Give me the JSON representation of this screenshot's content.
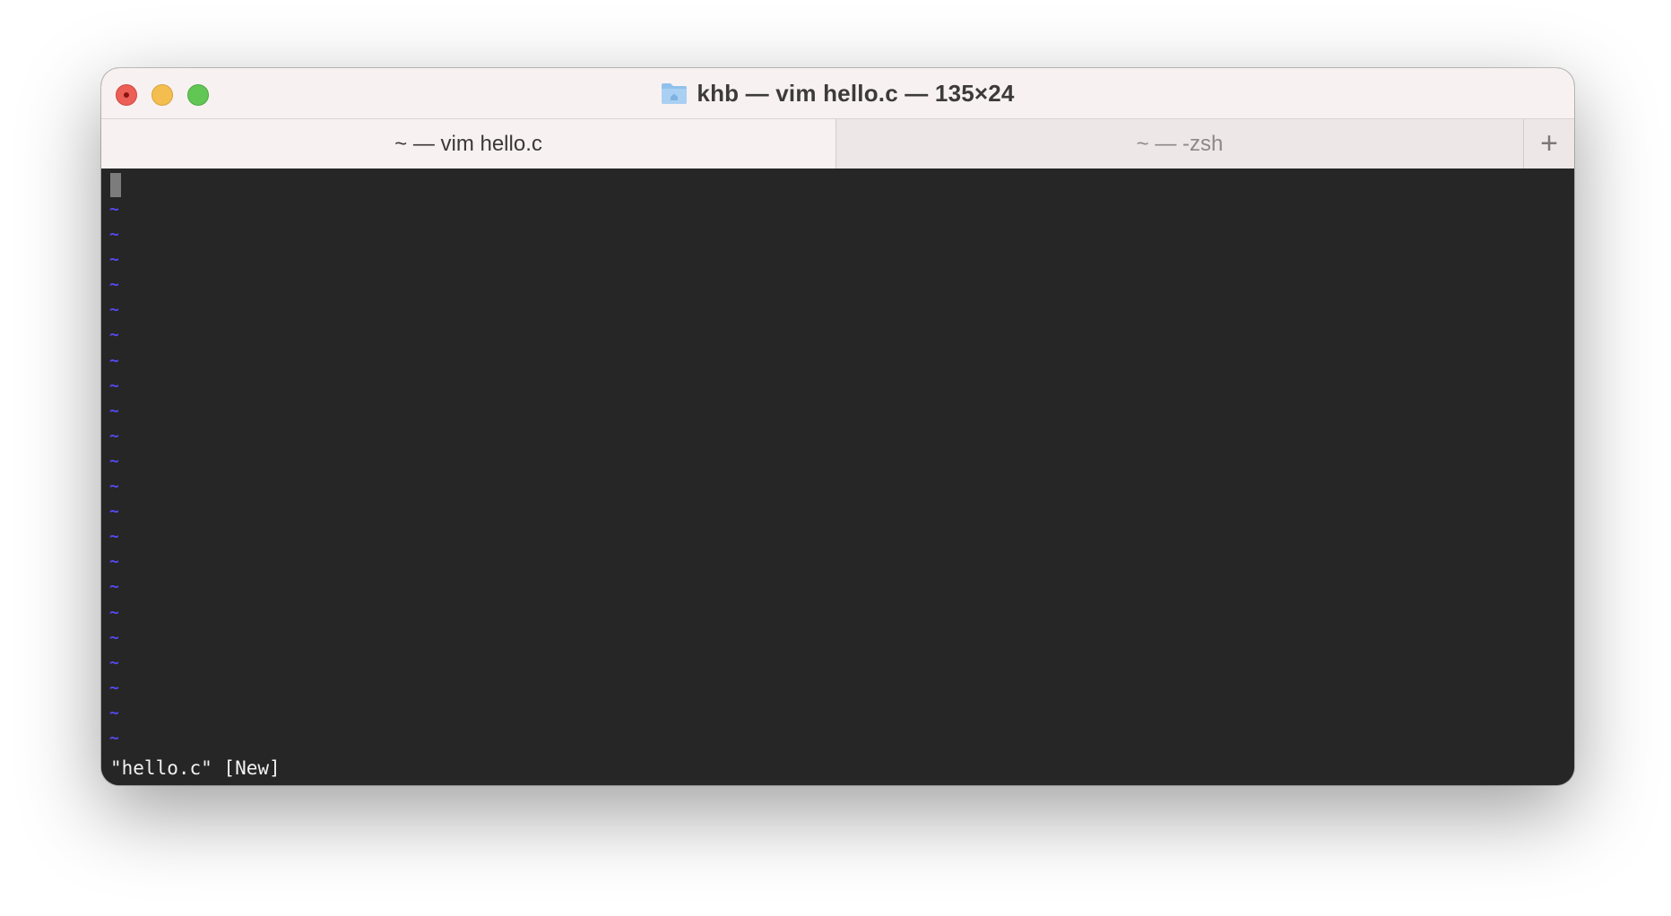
{
  "window": {
    "title": "khb — vim hello.c — 135×24",
    "folder_icon": "home-folder-icon"
  },
  "tabs": [
    {
      "label": "~ — vim hello.c",
      "active": true
    },
    {
      "label": "~ — -zsh",
      "active": false
    }
  ],
  "new_tab_label": "+",
  "terminal": {
    "tildes": [
      "~",
      "~",
      "~",
      "~",
      "~",
      "~",
      "~",
      "~",
      "~",
      "~",
      "~",
      "~",
      "~",
      "~",
      "~",
      "~",
      "~",
      "~",
      "~",
      "~",
      "~",
      "~"
    ],
    "status_line": "\"hello.c\" [New]"
  },
  "colors": {
    "terminal_bg": "#262626",
    "tilde": "#5349ee",
    "titlebar": "#f8f1f1"
  }
}
